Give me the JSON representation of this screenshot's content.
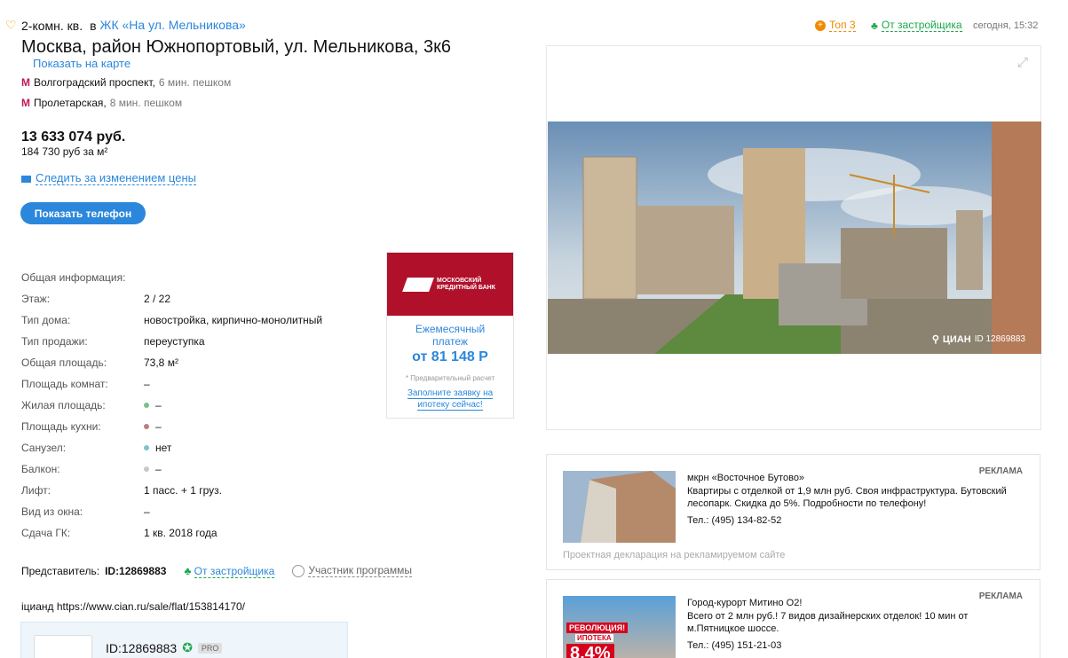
{
  "header": {
    "rooms": "2-комн. кв.",
    "in": "в",
    "complex": "ЖК «На ул. Мельникова»",
    "address": "Москва, район Южнопортовый, ул. Мельникова, 3к6",
    "map_link": "Показать на карте",
    "metro": [
      {
        "name": "Волгоградский проспект,",
        "walk": "6 мин. пешком"
      },
      {
        "name": "Пролетарская,",
        "walk": "8 мин. пешком"
      }
    ],
    "metro_icon": "М"
  },
  "price": {
    "total": "13 633 074 руб.",
    "per_m2": "184 730 руб за м²",
    "follow": "Следить за изменением цены"
  },
  "phone_button": "Показать телефон",
  "info": {
    "title": "Общая информация:",
    "rows": [
      {
        "k": "Этаж:",
        "v": "2 / 22",
        "dot": ""
      },
      {
        "k": "Тип дома:",
        "v": "новостройка, кирпично-монолитный",
        "dot": ""
      },
      {
        "k": "Тип продажи:",
        "v": "переуступка",
        "dot": ""
      },
      {
        "k": "Общая площадь:",
        "v": "73,8 м²",
        "dot": ""
      },
      {
        "k": "Площадь комнат:",
        "v": "–",
        "dot": ""
      },
      {
        "k": "Жилая площадь:",
        "v": "–",
        "dot": "#7dbf8a"
      },
      {
        "k": "Площадь кухни:",
        "v": "–",
        "dot": "#b88080"
      },
      {
        "k": "Санузел:",
        "v": "нет",
        "dot": "#7fc2c7"
      },
      {
        "k": "Балкон:",
        "v": "–",
        "dot": "#c8c8c8"
      },
      {
        "k": "Лифт:",
        "v": "1 пасс. + 1 груз.",
        "dot": ""
      },
      {
        "k": "Вид из окна:",
        "v": "–",
        "dot": ""
      },
      {
        "k": "Сдача ГК:",
        "v": "1 кв. 2018 года",
        "dot": ""
      }
    ]
  },
  "bank_ad": {
    "bank_name_1": "МОСКОВСКИЙ",
    "bank_name_2": "КРЕДИТНЫЙ БАНК",
    "payment_label": "Ежемесячный платеж",
    "payment_value": "от 81 148 Р",
    "note": "* Предварительный расчет",
    "cta": "Заполните заявку на ипотеку сейчас!"
  },
  "representative": {
    "label": "Представитель:",
    "id": "ID:12869883",
    "developer": "От застройщика",
    "program": "Участник программы"
  },
  "url_line": "iцианд https://www.cian.ru/sale/flat/153814170/",
  "agent_card": {
    "id": "ID:12869883",
    "pro": "PRO"
  },
  "top_right": {
    "top3": "Топ 3",
    "developer": "От застройщика",
    "date": "сегодня, 15:32"
  },
  "photo": {
    "watermark_brand": "ЦИАН",
    "watermark_id": "ID 12869883"
  },
  "ads": [
    {
      "label": "РЕКЛАМА",
      "title": "мкрн «Восточное Бутово»",
      "text": "Квартиры с отделкой от 1,9 млн руб. Своя инфраструктура. Бутовский лесопарк. Скидка до 5%. Подробности по телефону!",
      "phone": "Тел.: (495) 134-82-52",
      "declaration": "Проектная декларация на рекламируемом сайте"
    },
    {
      "label": "РЕКЛАМА",
      "title": "Город-курорт Митино О2!",
      "text": "Всего от 2 млн руб.! 7 видов дизайнерских отделок! 10 мин от м.Пятницкое шоссе.",
      "phone": "Тел.: (495) 151-21-03",
      "banner_line1": "РЕВОЛЮЦИЯ!",
      "banner_line2": "ИПОТЕКА",
      "banner_rate": "8,4%"
    }
  ],
  "colors": {
    "accent": "#2b87db",
    "green": "#1aa74a",
    "orange": "#f08a00",
    "bank_red": "#b0102a",
    "metro": "#c0185c"
  }
}
